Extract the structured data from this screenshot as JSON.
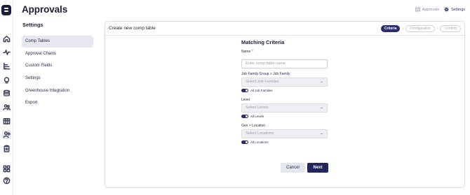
{
  "app": {
    "page_title": "Approvals",
    "rail_icons": [
      "logo",
      "home-icon",
      "activity-icon",
      "org-chart-icon",
      "lightbulb-icon",
      "database-icon",
      "people-icon",
      "grid-table-icon",
      "user-plus-icon",
      "clipboard-icon",
      "apps-icon",
      "help-icon"
    ]
  },
  "topnav": {
    "approvals_label": "Approvals",
    "settings_label": "Settings"
  },
  "settings": {
    "heading": "Settings",
    "items": [
      {
        "label": "Comp Tables",
        "active": true
      },
      {
        "label": "Approval Chains",
        "active": false
      },
      {
        "label": "Custom Fields",
        "active": false
      },
      {
        "label": "Settings",
        "active": false
      },
      {
        "label": "Greenhouse Integration",
        "active": false
      },
      {
        "label": "Export",
        "active": false
      }
    ]
  },
  "card": {
    "title": "Create new comp table",
    "steps": [
      {
        "label": "Criteria",
        "active": true
      },
      {
        "label": "Configuration",
        "active": false
      },
      {
        "label": "Confirm",
        "active": false
      }
    ]
  },
  "form": {
    "title": "Matching Criteria",
    "name_label": "Name",
    "name_required_mark": "*",
    "name_placeholder": "Enter comp table name",
    "job_family_label": "Job Family Group > Job Family",
    "job_family_placeholder": "Select Job Families",
    "job_family_toggle": "All Job Families",
    "level_label": "Level",
    "level_placeholder": "Select Levels",
    "level_toggle": "All Levels",
    "location_label": "Geo > Location",
    "location_placeholder": "Select Locations",
    "location_toggle": "All Locations",
    "cancel_label": "Cancel",
    "next_label": "Next"
  },
  "colors": {
    "accent": "#2b2d6e",
    "primary_button": "#23255f",
    "active_nav_bg": "#e7e7f1"
  }
}
